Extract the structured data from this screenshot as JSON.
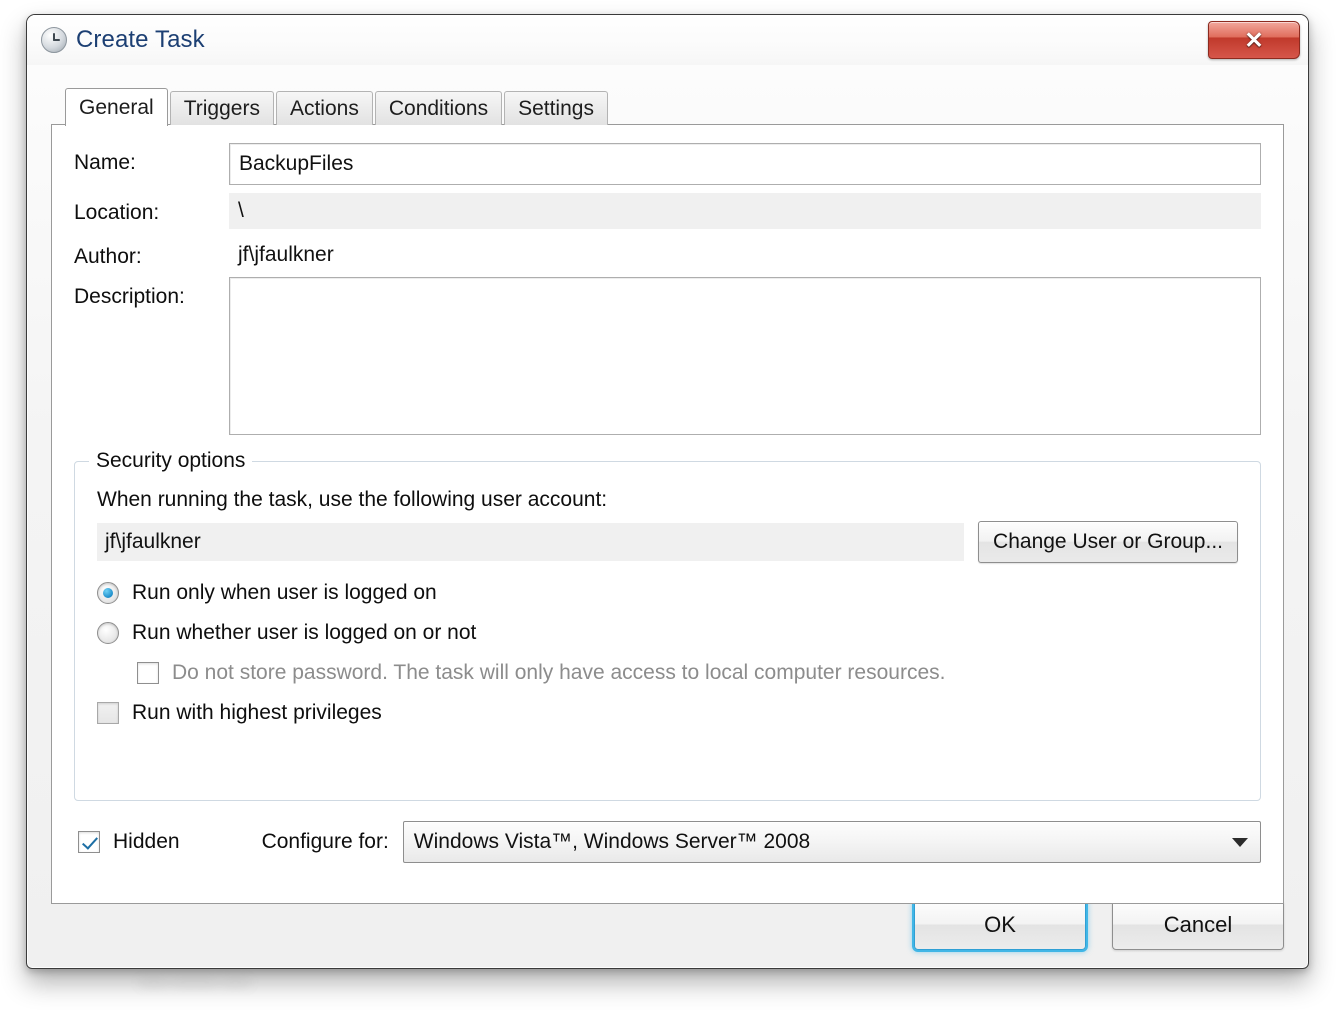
{
  "window": {
    "title": "Create Task",
    "title_icon": "clock-icon",
    "close_label": "✕"
  },
  "background": {
    "blurred_strip": "•  ••  ••   ••••  ••••••••  •••••••",
    "blurred_bottom": "•••••   ••••••••   •••••"
  },
  "tabs": [
    {
      "label": "General",
      "active": true
    },
    {
      "label": "Triggers",
      "active": false
    },
    {
      "label": "Actions",
      "active": false
    },
    {
      "label": "Conditions",
      "active": false
    },
    {
      "label": "Settings",
      "active": false
    }
  ],
  "general": {
    "name_label": "Name:",
    "name_value": "BackupFiles",
    "name_placeholder": "",
    "location_label": "Location:",
    "location_value": "\\",
    "author_label": "Author:",
    "author_value": "jf\\jfaulkner",
    "description_label": "Description:",
    "description_value": "",
    "description_placeholder": ""
  },
  "security": {
    "legend": "Security options",
    "prompt": "When running the task, use the following user account:",
    "account_value": "jf\\jfaulkner",
    "change_user_label": "Change User or Group...",
    "radio_logged_on": "Run only when user is logged on",
    "radio_whether_logged_on": "Run whether user is logged on or not",
    "checkbox_no_store_password": "Do not store password.  The task will only have access to local computer resources.",
    "checkbox_highest_privileges": "Run with highest privileges"
  },
  "bottom": {
    "hidden_label": "Hidden",
    "configure_label": "Configure for:",
    "configure_value": "Windows Vista™, Windows Server™ 2008"
  },
  "footer": {
    "ok_label": "OK",
    "cancel_label": "Cancel"
  },
  "colors": {
    "accent_blue": "#41b6e6",
    "radio_dot": "#1e8ecb",
    "check_mark": "#1d6fa5",
    "close_red": "#c0392b",
    "title_text": "#1c3f73"
  }
}
